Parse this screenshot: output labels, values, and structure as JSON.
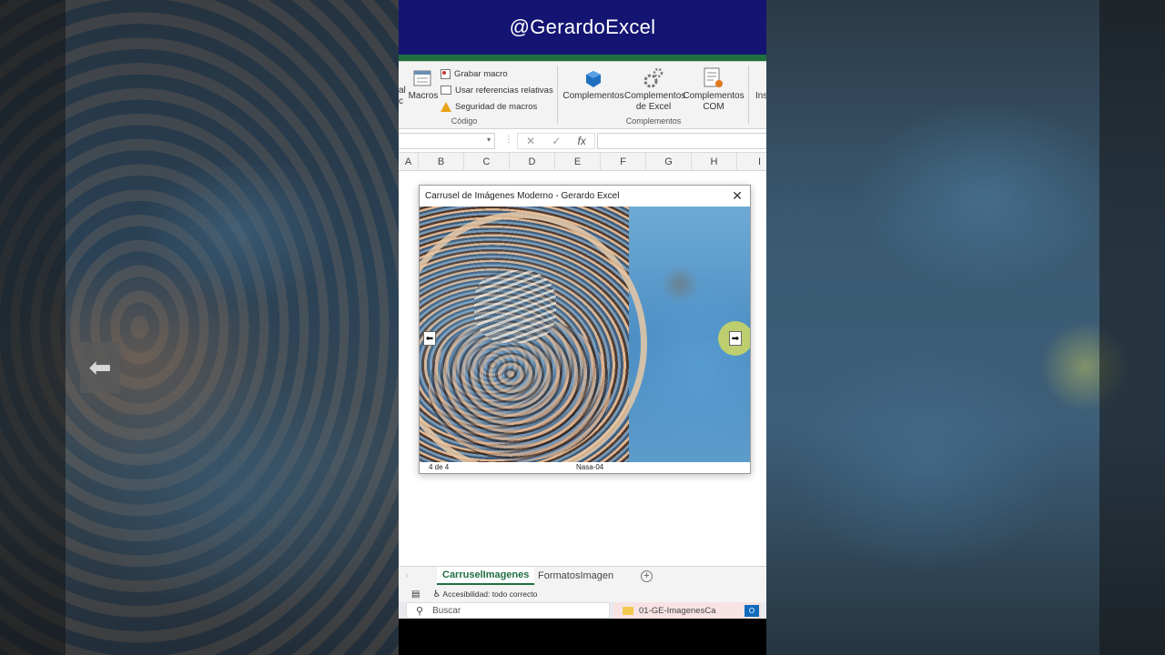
{
  "banner": {
    "handle": "@GerardoExcel"
  },
  "ribbon": {
    "partial_left_line1": "al",
    "partial_left_line2": "c",
    "macros_label": "Macros",
    "record_macro": "Grabar macro",
    "relative_refs": "Usar referencias relativas",
    "macro_security": "Seguridad de macros",
    "code_group": "Código",
    "addins_label": "Complementos",
    "excel_addins_line1": "Complementos",
    "excel_addins_line2": "de Excel",
    "com_addins_line1": "Complementos",
    "com_addins_line2": "COM",
    "addins_group": "Complementos",
    "partial_right": "Ins"
  },
  "formula_bar": {
    "cancel": "✕",
    "confirm": "✓",
    "fx": "fx"
  },
  "columns": [
    "A",
    "B",
    "C",
    "D",
    "E",
    "F",
    "G",
    "H",
    "I"
  ],
  "dialog": {
    "title": "Carrusel de Imágenes Moderno - Gerardo Excel",
    "close": "✕",
    "counter": "4 de 4",
    "image_name": "Nasa-04",
    "prev_icon": "⬅",
    "next_icon": "➡"
  },
  "sheet_tabs": {
    "active": "CarruselImagenes",
    "other": "FormatosImagen",
    "add": "+"
  },
  "status_bar": {
    "accessibility": "Accesibilidad: todo correcto"
  },
  "taskbar": {
    "search_placeholder": "Buscar",
    "task_item": "01-GE-ImagenesCa"
  }
}
